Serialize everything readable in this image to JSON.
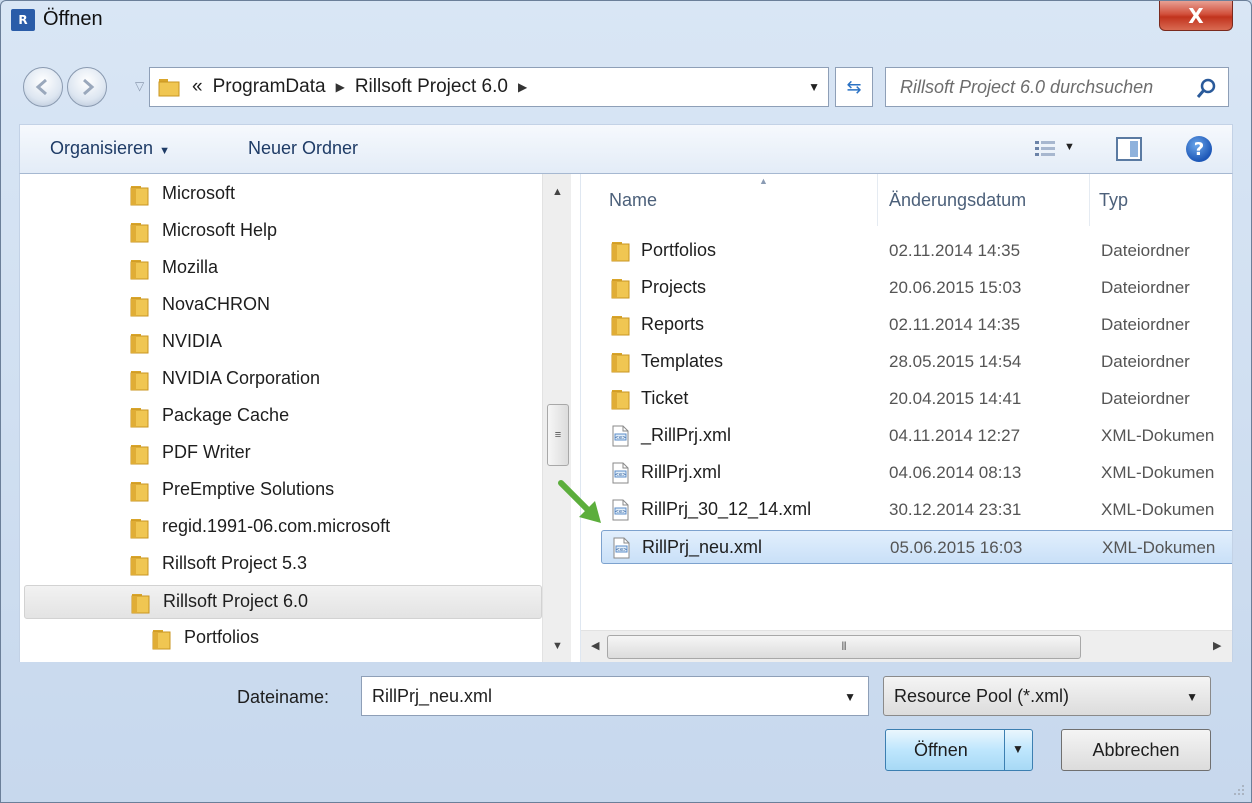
{
  "window": {
    "title": "Öffnen",
    "app_icon_text": "R",
    "close_glyph": "X"
  },
  "address": {
    "overflow": "«",
    "path": [
      "ProgramData",
      "Rillsoft Project 6.0"
    ],
    "search_placeholder": "Rillsoft Project 6.0 durchsuchen"
  },
  "toolbar": {
    "organize_label": "Organisieren",
    "new_folder_label": "Neuer Ordner",
    "help_glyph": "?"
  },
  "tree": {
    "items": [
      {
        "label": "Microsoft",
        "level": 0
      },
      {
        "label": "Microsoft Help",
        "level": 0
      },
      {
        "label": "Mozilla",
        "level": 0
      },
      {
        "label": "NovaCHRON",
        "level": 0
      },
      {
        "label": "NVIDIA",
        "level": 0
      },
      {
        "label": "NVIDIA Corporation",
        "level": 0
      },
      {
        "label": "Package Cache",
        "level": 0
      },
      {
        "label": "PDF Writer",
        "level": 0
      },
      {
        "label": "PreEmptive Solutions",
        "level": 0
      },
      {
        "label": "regid.1991-06.com.microsoft",
        "level": 0
      },
      {
        "label": "Rillsoft Project 5.3",
        "level": 0
      },
      {
        "label": "Rillsoft Project 6.0",
        "level": 0,
        "selected": true
      },
      {
        "label": "Portfolios",
        "level": 1
      }
    ]
  },
  "files": {
    "columns": {
      "name": "Name",
      "date": "Änderungsdatum",
      "type": "Typ"
    },
    "rows": [
      {
        "name": "Portfolios",
        "date": "02.11.2014 14:35",
        "type": "Dateiordner",
        "kind": "folder"
      },
      {
        "name": "Projects",
        "date": "20.06.2015 15:03",
        "type": "Dateiordner",
        "kind": "folder"
      },
      {
        "name": "Reports",
        "date": "02.11.2014 14:35",
        "type": "Dateiordner",
        "kind": "folder"
      },
      {
        "name": "Templates",
        "date": "28.05.2015 14:54",
        "type": "Dateiordner",
        "kind": "folder"
      },
      {
        "name": "Ticket",
        "date": "20.04.2015 14:41",
        "type": "Dateiordner",
        "kind": "folder"
      },
      {
        "name": "_RillPrj.xml",
        "date": "04.11.2014 12:27",
        "type": "XML-Dokumen",
        "kind": "xml"
      },
      {
        "name": "RillPrj.xml",
        "date": "04.06.2014 08:13",
        "type": "XML-Dokumen",
        "kind": "xml"
      },
      {
        "name": "RillPrj_30_12_14.xml",
        "date": "30.12.2014 23:31",
        "type": "XML-Dokumen",
        "kind": "xml"
      },
      {
        "name": "RillPrj_neu.xml",
        "date": "05.06.2015 16:03",
        "type": "XML-Dokumen",
        "kind": "xml",
        "selected": true
      }
    ]
  },
  "bottom": {
    "filename_label": "Dateiname:",
    "filename_value": "RillPrj_neu.xml",
    "filetype_value": "Resource Pool (*.xml)",
    "open_label": "Öffnen",
    "cancel_label": "Abbrechen"
  },
  "colors": {
    "accent": "#3c7fb1",
    "selection": "#c9e0f8",
    "folder": "#e8b93a",
    "arrow": "#5cae3c"
  }
}
